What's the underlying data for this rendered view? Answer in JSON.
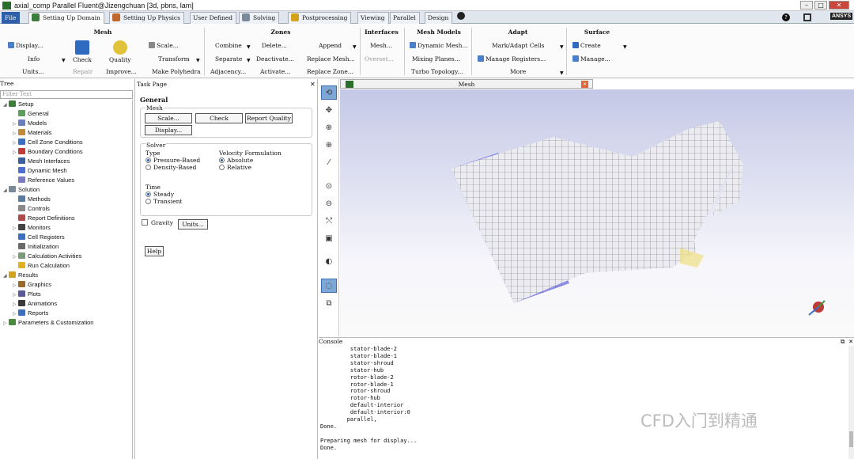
{
  "window": {
    "title": "axial_comp Parallel Fluent@Jizengchuan  [3d, pbns, lam]",
    "logo": "ANSYS"
  },
  "tabs": [
    {
      "label": "File"
    },
    {
      "label": "Setting Up Domain"
    },
    {
      "label": "Setting Up Physics"
    },
    {
      "label": "User Defined"
    },
    {
      "label": "Solving"
    },
    {
      "label": "Postprocessing"
    },
    {
      "label": "Viewing"
    },
    {
      "label": "Parallel"
    },
    {
      "label": "Design"
    }
  ],
  "ribbon": {
    "groups": [
      "Mesh",
      "Zones",
      "Interfaces",
      "Mesh Models",
      "Adapt",
      "Surface"
    ],
    "mesh": {
      "display": "Display...",
      "info": "Info",
      "units": "Units...",
      "check": "Check",
      "quality": "Quality",
      "repair": "Repair",
      "improve": "Improve...",
      "scale": "Scale...",
      "transform": "Transform",
      "make_polyhedra": "Make Polyhedra"
    },
    "zones": {
      "combine": "Combine",
      "separate": "Separate",
      "adjacency": "Adjacency...",
      "delete": "Delete...",
      "deactivate": "Deactivate...",
      "activate": "Activate...",
      "append": "Append",
      "replace_mesh": "Replace Mesh...",
      "replace_zone": "Replace Zone..."
    },
    "interfaces": {
      "mesh": "Mesh...",
      "overset": "Overset..."
    },
    "mesh_models": {
      "dynamic_mesh": "Dynamic Mesh...",
      "mixing_planes": "Mixing Planes...",
      "turbo_topology": "Turbo Topology..."
    },
    "adapt": {
      "mark_adapt": "Mark/Adapt Cells",
      "manage_registers": "Manage Registers...",
      "more": "More"
    },
    "surface": {
      "create": "Create",
      "manage": "Manage..."
    }
  },
  "tree": {
    "header": "Tree",
    "filter_placeholder": "Filter Text",
    "nodes": [
      "Setup",
      "General",
      "Models",
      "Materials",
      "Cell Zone Conditions",
      "Boundary Conditions",
      "Mesh Interfaces",
      "Dynamic Mesh",
      "Reference Values",
      "Solution",
      "Methods",
      "Controls",
      "Report Definitions",
      "Monitors",
      "Cell Registers",
      "Initialization",
      "Calculation Activities",
      "Run Calculation",
      "Results",
      "Graphics",
      "Plots",
      "Animations",
      "Reports",
      "Parameters & Customization"
    ]
  },
  "task": {
    "header": "Task Page",
    "title": "General",
    "mesh_group": "Mesh",
    "scale": "Scale...",
    "check": "Check",
    "report_quality": "Report Quality",
    "display": "Display...",
    "solver_group": "Solver",
    "type_label": "Type",
    "pressure_based": "Pressure-Based",
    "density_based": "Density-Based",
    "velocity_label": "Velocity Formulation",
    "absolute": "Absolute",
    "relative": "Relative",
    "time_label": "Time",
    "steady": "Steady",
    "transient": "Transient",
    "gravity": "Gravity",
    "units": "Units...",
    "help": "Help"
  },
  "graphics": {
    "tab_label": "Mesh"
  },
  "console": {
    "header": "Console",
    "lines": [
      "         stator-blade-2",
      "         stator-blade-1",
      "         stator-shroud",
      "         stator-hub",
      "         rotor-blade-2",
      "         rotor-blade-1",
      "         rotor-shroud",
      "         rotor-hub",
      "         default-interior",
      "         default-interior:0",
      "        parallel,",
      "Done.",
      "",
      "Preparing mesh for display...",
      "Done."
    ]
  },
  "watermark": "CFD入门到精通",
  "colors": {
    "accent": "#4b7fc9",
    "selected_tool": "#7fa7d6",
    "mesh_fill": "#e8e8ee",
    "mesh_side": "#8c8ee0"
  }
}
